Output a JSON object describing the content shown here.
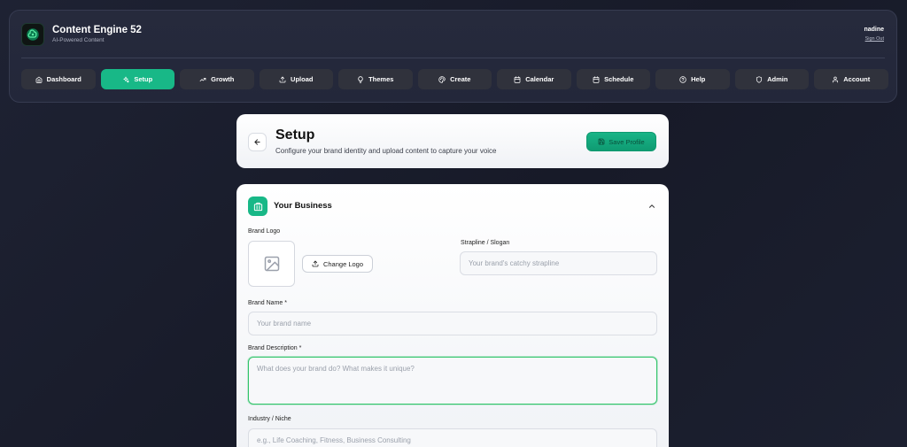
{
  "app": {
    "title": "Content Engine 52",
    "subtitle": "AI-Powered Content",
    "user": "nadine",
    "sign_out": "Sign Out"
  },
  "nav": [
    {
      "label": "Dashboard",
      "icon": "home-icon",
      "active": false
    },
    {
      "label": "Setup",
      "icon": "sparkles-icon",
      "active": true
    },
    {
      "label": "Growth",
      "icon": "trending-up-icon",
      "active": false
    },
    {
      "label": "Upload",
      "icon": "upload-icon",
      "active": false
    },
    {
      "label": "Themes",
      "icon": "lightbulb-icon",
      "active": false
    },
    {
      "label": "Create",
      "icon": "palette-icon",
      "active": false
    },
    {
      "label": "Calendar",
      "icon": "calendar-icon",
      "active": false
    },
    {
      "label": "Schedule",
      "icon": "calendar-icon",
      "active": false
    },
    {
      "label": "Help",
      "icon": "help-circle-icon",
      "active": false
    },
    {
      "label": "Admin",
      "icon": "shield-icon",
      "active": false
    },
    {
      "label": "Account",
      "icon": "user-icon",
      "active": false
    }
  ],
  "page": {
    "title": "Setup",
    "subtitle": "Configure your brand identity and upload content to capture your voice",
    "save_label": "Save Profile"
  },
  "business": {
    "section_title": "Your Business",
    "brand_logo_label": "Brand Logo",
    "change_logo_label": "Change Logo",
    "strapline_label": "Strapline / Slogan",
    "strapline_placeholder": "Your brand's catchy strapline",
    "brand_name_label": "Brand Name *",
    "brand_name_placeholder": "Your brand name",
    "brand_description_label": "Brand Description *",
    "brand_description_placeholder": "What does your brand do? What makes it unique?",
    "industry_label": "Industry / Niche",
    "industry_placeholder": "e.g., Life Coaching, Fitness, Business Consulting"
  },
  "colors": {
    "accent": "#18b887",
    "focus_border": "#31c46a",
    "nav_bg": "#30323c"
  }
}
